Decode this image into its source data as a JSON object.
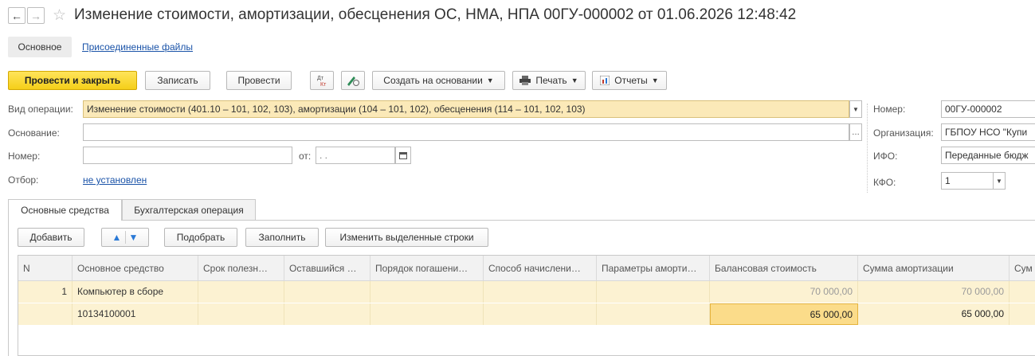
{
  "window": {
    "back_glyph": "←",
    "forward_glyph": "→",
    "favorite_icon": "star-icon",
    "title": "Изменение стоимости, амортизации, обесценения ОС, НМА, НПА 00ГУ-000002 от 01.06.2026 12:48:42"
  },
  "sections": {
    "main": "Основное",
    "files": "Присоединенные файлы"
  },
  "toolbar": {
    "post_close": "Провести и закрыть",
    "save": "Записать",
    "post": "Провести",
    "dt_kt": "Дт Кт",
    "create_based": "Создать на основании",
    "print": "Печать",
    "reports": "Отчеты"
  },
  "form": {
    "operation_label": "Вид операции:",
    "operation_value": "Изменение стоимости (401.10 – 101, 102, 103), амортизации (104 – 101, 102), обесценения (114 – 101, 102, 103)",
    "basis_label": "Основание:",
    "basis_value": "",
    "number_label": "Номер:",
    "number_value": "",
    "from_label": "от:",
    "from_value": "  .  .",
    "filter_label": "Отбор:",
    "filter_value": "не установлен",
    "doc_number_label": "Номер:",
    "doc_number_value": "00ГУ-000002",
    "org_label": "Организация:",
    "org_value": "ГБПОУ НСО \"Купи",
    "ifo_label": "ИФО:",
    "ifo_value": "Переданные бюдж",
    "kfo_label": "КФО:",
    "kfo_value": "1"
  },
  "tabs": [
    "Основные средства",
    "Бухгалтерская операция"
  ],
  "table_toolbar": {
    "add": "Добавить",
    "pick": "Подобрать",
    "fill": "Заполнить",
    "edit_selected": "Изменить выделенные строки"
  },
  "table": {
    "columns": [
      "N",
      "Основное средство",
      "Срок полезн…",
      "Оставшийся …",
      "Порядок погашени…",
      "Способ начислени…",
      "Параметры аморти…",
      "Балансовая стоимость",
      "Сумма амортизации",
      "Сум"
    ],
    "rows": [
      {
        "n": "1",
        "asset": "Компьютер в сборе",
        "inventory": "10134100001",
        "balance_old": "70 000,00",
        "amort_old": "70 000,00",
        "balance_new": "65 000,00",
        "amort_new": "65 000,00"
      }
    ]
  },
  "colors": {
    "primary_button": "#f5cf19",
    "highlight_field": "#fbe9b8",
    "row_background": "#fcf2d2",
    "selected_cell": "#fbdc8a",
    "link": "#1a53a8"
  }
}
